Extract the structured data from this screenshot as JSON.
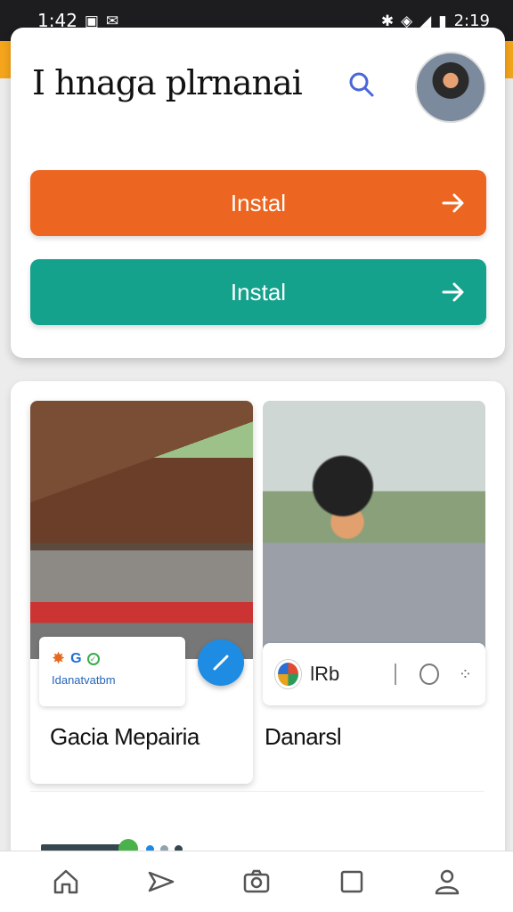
{
  "status_bar": {
    "time": "1:42",
    "battery": "2:19"
  },
  "header": {
    "title": "I hnaga plrnanai",
    "search_icon": "search-icon"
  },
  "actions": [
    {
      "label": "Instal",
      "color": "#ec6521"
    },
    {
      "label": "Instal",
      "color": "#14a28d"
    }
  ],
  "posts": [
    {
      "meta_letter": "G",
      "meta_subtitle": "Idanatvatbm",
      "caption": "Gacia Mepairia"
    },
    {
      "app_label": "lRb",
      "caption": "Danarsl"
    }
  ],
  "bottom_nav": [
    {
      "icon": "home-icon"
    },
    {
      "icon": "send-icon"
    },
    {
      "icon": "camera-icon"
    },
    {
      "icon": "square-icon"
    },
    {
      "icon": "profile-icon"
    }
  ]
}
